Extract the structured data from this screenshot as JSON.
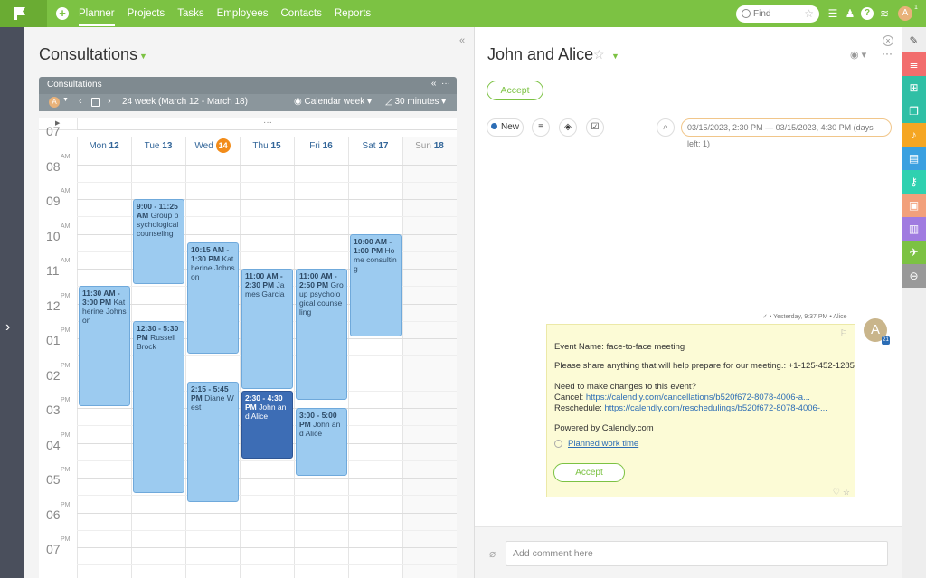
{
  "topbar": {
    "nav": [
      "Planner",
      "Projects",
      "Tasks",
      "Employees",
      "Contacts",
      "Reports"
    ],
    "active_nav": "Planner",
    "find_placeholder": "Find",
    "avatar_initial": "A",
    "avatar_badge": "1",
    "accent": "#7cc243"
  },
  "left": {
    "title": "Consultations",
    "calendar": {
      "header_title": "Consultations",
      "user_initial": "A",
      "week_label": "24 week (March 12 - March 18)",
      "view_label": "Calendar week",
      "step_label": "30 minutes",
      "more_label": "···",
      "days": [
        {
          "name": "Mon",
          "num": "12"
        },
        {
          "name": "Tue",
          "num": "13"
        },
        {
          "name": "Wed",
          "num": "14",
          "today": true
        },
        {
          "name": "Thu",
          "num": "15"
        },
        {
          "name": "Fri",
          "num": "16"
        },
        {
          "name": "Sat",
          "num": "17"
        },
        {
          "name": "Sun",
          "num": "18"
        }
      ],
      "hours": [
        {
          "h": "07",
          "ampm": ""
        },
        {
          "h": "08",
          "ampm": "AM"
        },
        {
          "h": "09",
          "ampm": "AM"
        },
        {
          "h": "10",
          "ampm": "AM"
        },
        {
          "h": "11",
          "ampm": "AM"
        },
        {
          "h": "12",
          "ampm": "PM"
        },
        {
          "h": "01",
          "ampm": "PM"
        },
        {
          "h": "02",
          "ampm": "PM"
        },
        {
          "h": "03",
          "ampm": "PM"
        },
        {
          "h": "04",
          "ampm": "PM"
        },
        {
          "h": "05",
          "ampm": "PM"
        },
        {
          "h": "06",
          "ampm": "PM"
        },
        {
          "h": "07",
          "ampm": "PM"
        }
      ],
      "events": [
        {
          "day": 0,
          "start": 11.5,
          "end": 15,
          "time": "11:30 AM - 3:00 PM",
          "title": "Katherine Johnson"
        },
        {
          "day": 1,
          "start": 9,
          "end": 11.5,
          "time": "9:00 - 11:25 AM",
          "title": "Group psychological counseling"
        },
        {
          "day": 1,
          "start": 12.5,
          "end": 17.5,
          "time": "12:30 - 5:30 PM",
          "title": "Russell Brock"
        },
        {
          "day": 2,
          "start": 10.25,
          "end": 13.5,
          "time": "10:15 AM - 1:30 PM",
          "title": "Katherine Johnson"
        },
        {
          "day": 2,
          "start": 14.25,
          "end": 17.75,
          "time": "2:15 - 5:45 PM",
          "title": "Diane West"
        },
        {
          "day": 3,
          "start": 11,
          "end": 14.5,
          "time": "11:00 AM - 2:30 PM",
          "title": "James Garcia"
        },
        {
          "day": 3,
          "start": 14.5,
          "end": 16.5,
          "time": "2:30 - 4:30 PM",
          "title": "John and Alice",
          "selected": true
        },
        {
          "day": 4,
          "start": 11,
          "end": 14.83,
          "time": "11:00 AM - 2:50 PM",
          "title": "Group psychological counseling"
        },
        {
          "day": 4,
          "start": 15,
          "end": 17,
          "time": "3:00 - 5:00 PM",
          "title": "John and Alice"
        },
        {
          "day": 5,
          "start": 10,
          "end": 13,
          "time": "10:00 AM - 1:00 PM",
          "title": "Home consulting"
        }
      ]
    }
  },
  "right": {
    "title": "John and Alice",
    "accept_label": "Accept",
    "status_label": "New",
    "date_range": "03/15/2023, 2:30 PM — 03/15/2023, 4:30 PM (days left: 1)",
    "comment": {
      "meta": "✓ • Yesterday, 9:37 PM • Alice",
      "author_initial": "A",
      "author_badge": "21",
      "lines": {
        "event_name": "Event Name: face-to-face meeting",
        "share": "Please share anything that will help prepare for our meeting.: +1-125-452-1285",
        "changes": "Need to make changes to this event?",
        "cancel_label": "Cancel: ",
        "cancel_link": "https://calendly.com/cancellations/b520f672-8078-4006-a...",
        "reschedule_label": "Reschedule: ",
        "reschedule_link": "https://calendly.com/reschedulings/b520f672-8078-4006-...",
        "powered": "Powered by Calendly.com"
      },
      "planned_label": "Planned work time",
      "accept_label": "Accept"
    },
    "comment_placeholder": "Add comment here"
  },
  "right_bar": {
    "colors": [
      "#7cc243",
      "#f26d6d",
      "#2fbfa5",
      "#2fbfa5",
      "#f5a623",
      "#3aa0e0",
      "#2fd1b0",
      "#f2a07b",
      "#a07be0",
      "#7cc243",
      "#999999"
    ],
    "icons": [
      "edit-icon",
      "list-icon",
      "sitemap-icon",
      "files-icon",
      "bell-icon",
      "clipboard-icon",
      "key-icon",
      "contact-icon",
      "chart-icon",
      "send-icon",
      "minus-circle-icon"
    ]
  }
}
